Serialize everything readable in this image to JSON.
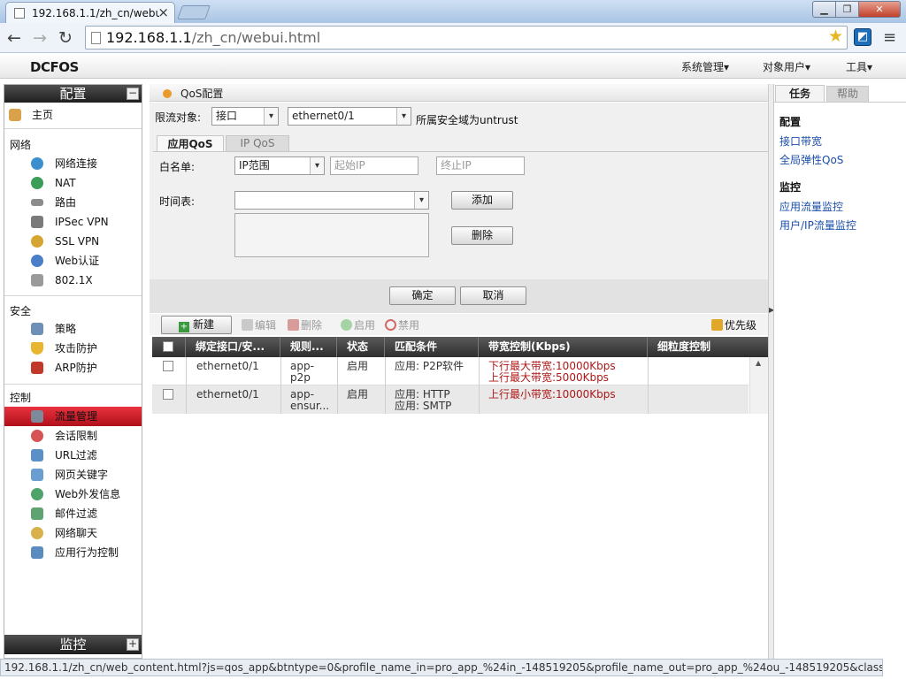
{
  "browser": {
    "tab_title": "192.168.1.1/zh_cn/webu",
    "url_host": "192.168.1.1",
    "url_path": "/zh_cn/webui.html",
    "status_url": "192.168.1.1/zh_cn/web_content.html?js=qos_app&btntype=0&profile_name_in=pro_app_%24in_-148519205&profile_name_out=pro_app_%24ou_-148519205&class_name..."
  },
  "header": {
    "logo": "DCFOS",
    "menus": [
      "系统管理▾",
      "对象用户▾",
      "工具▾"
    ]
  },
  "left_panel": {
    "title": "配置",
    "home": "主页",
    "sections": [
      {
        "label": "网络",
        "items": [
          "网络连接",
          "NAT",
          "路由",
          "IPSec VPN",
          "SSL VPN",
          "Web认证",
          "802.1X"
        ]
      },
      {
        "label": "安全",
        "items": [
          "策略",
          "攻击防护",
          "ARP防护"
        ]
      },
      {
        "label": "控制",
        "items": [
          "流量管理",
          "会话限制",
          "URL过滤",
          "网页关键字",
          "Web外发信息",
          "邮件过滤",
          "网络聊天",
          "应用行为控制"
        ]
      }
    ],
    "selected_item": "流量管理",
    "monitor_title": "监控"
  },
  "main": {
    "title": "QoS配置",
    "limit_target_label": "限流对象:",
    "limit_target_value": "接口",
    "interface_value": "ethernet0/1",
    "zone_note": "所属安全域为untrust",
    "tabs": [
      "应用QoS",
      "IP QoS"
    ],
    "whitelist_label": "白名单:",
    "whitelist_type": "IP范围",
    "start_ip_placeholder": "起始IP",
    "end_ip_placeholder": "终止IP",
    "schedule_label": "时间表:",
    "schedule_value": "",
    "add_button": "添加",
    "delete_button": "删除",
    "ok_button": "确定",
    "cancel_button": "取消",
    "actions": {
      "new": "新建",
      "edit": "编辑",
      "delete": "删除",
      "enable": "启用",
      "disable": "禁用",
      "priority": "优先级"
    },
    "table": {
      "headers": [
        "绑定接口/安...",
        "规则...",
        "状态",
        "匹配条件",
        "带宽控制(Kbps)",
        "细粒度控制"
      ],
      "rows": [
        {
          "interface": "ethernet0/1",
          "rule": [
            "app-",
            "p2p"
          ],
          "status": "启用",
          "match": [
            "应用: P2P软件"
          ],
          "bandwidth": [
            "下行最大带宽:10000Kbps",
            "上行最大带宽:5000Kbps"
          ]
        },
        {
          "interface": "ethernet0/1",
          "rule": [
            "app-",
            "ensur..."
          ],
          "status": "启用",
          "match": [
            "应用: HTTP",
            "应用: SMTP"
          ],
          "bandwidth": [
            "上行最小带宽:10000Kbps"
          ]
        }
      ]
    }
  },
  "right_panel": {
    "tabs": [
      "任务",
      "帮助"
    ],
    "groups": [
      {
        "title": "配置",
        "links": [
          "接口带宽",
          "全局弹性QoS"
        ]
      },
      {
        "title": "监控",
        "links": [
          "应用流量监控",
          "用户/IP流量监控"
        ]
      }
    ]
  },
  "colors": {
    "selected_red": "#c8161f",
    "bandwidth_red": "#b01818",
    "link_blue": "#1b4fa8",
    "header_dark": "#2e2e2e"
  }
}
